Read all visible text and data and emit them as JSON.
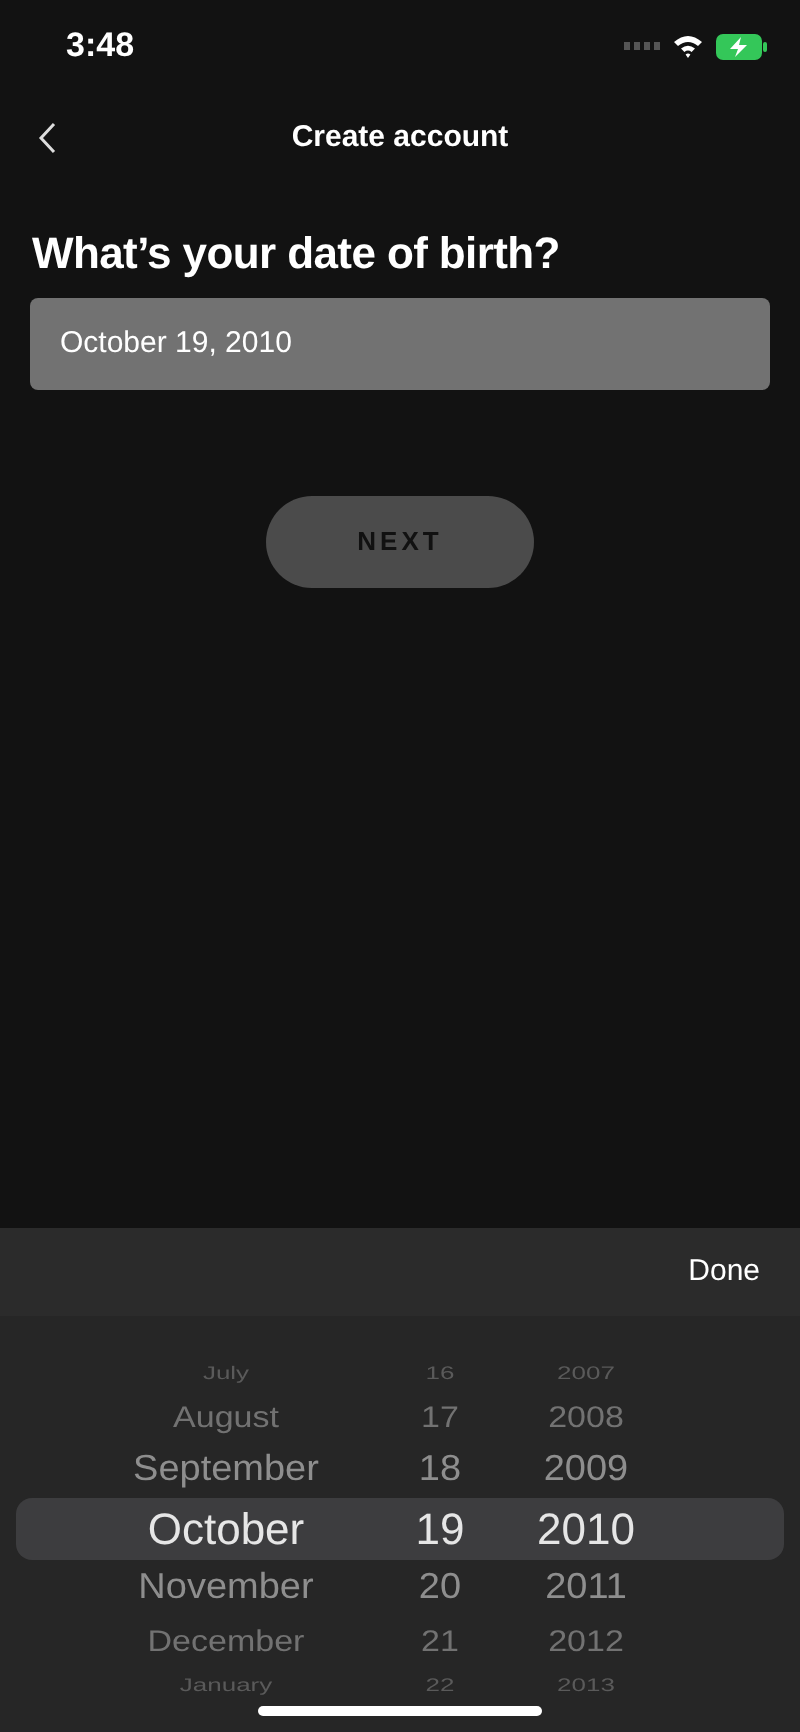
{
  "status_bar": {
    "time": "3:48"
  },
  "header": {
    "title": "Create account"
  },
  "question": "What’s your date of birth?",
  "date_field": {
    "value": "October 19, 2010"
  },
  "next_button": {
    "label": "NEXT",
    "disabled": true
  },
  "picker": {
    "done_label": "Done",
    "rows": [
      {
        "month": "July",
        "day": "16",
        "year": "2007",
        "selected": false
      },
      {
        "month": "August",
        "day": "17",
        "year": "2008",
        "selected": false
      },
      {
        "month": "September",
        "day": "18",
        "year": "2009",
        "selected": false
      },
      {
        "month": "October",
        "day": "19",
        "year": "2010",
        "selected": true
      },
      {
        "month": "November",
        "day": "20",
        "year": "2011",
        "selected": false
      },
      {
        "month": "December",
        "day": "21",
        "year": "2012",
        "selected": false
      },
      {
        "month": "January",
        "day": "22",
        "year": "2013",
        "selected": false
      }
    ]
  }
}
